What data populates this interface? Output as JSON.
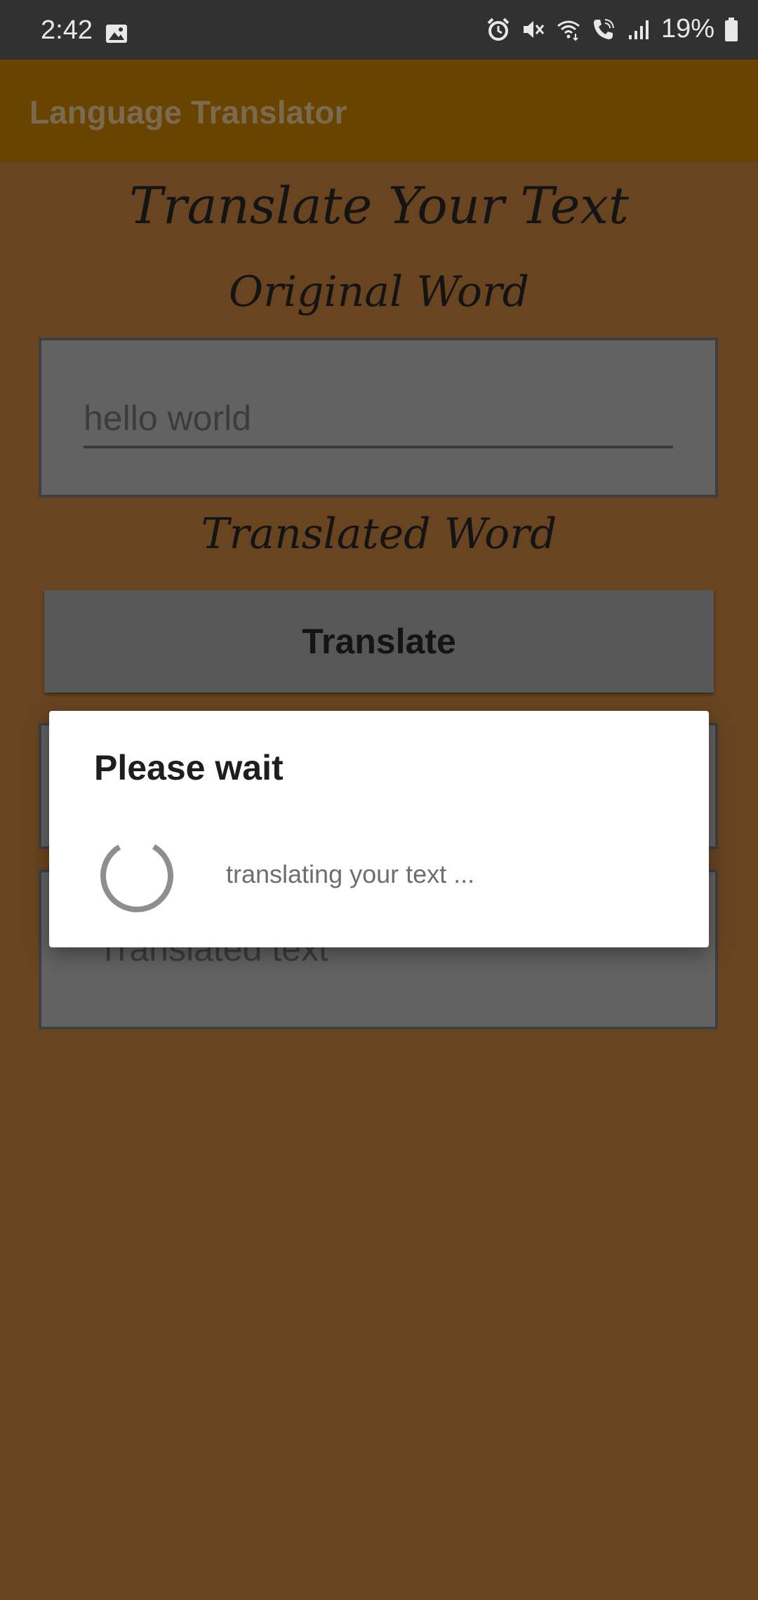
{
  "status_bar": {
    "time": "2:42",
    "battery_percent": "19%",
    "icons": [
      "image-icon",
      "alarm-icon",
      "mute-icon",
      "wifi-icon",
      "wifi-calling-icon",
      "signal-icon",
      "battery-icon"
    ]
  },
  "app_bar": {
    "title": "Language Translator"
  },
  "main": {
    "heading": "Translate Your Text",
    "original_label": "Original Word",
    "input_value": "hello world",
    "translated_label": "Translated Word",
    "translate_button": "Translate",
    "output_placeholder": "Translated text"
  },
  "dialog": {
    "title": "Please wait",
    "message": "translating your text ..."
  },
  "colors": {
    "background": "#684421",
    "app_bar": "#694300",
    "status_bar": "#313131",
    "dialog": "#ffffff"
  }
}
